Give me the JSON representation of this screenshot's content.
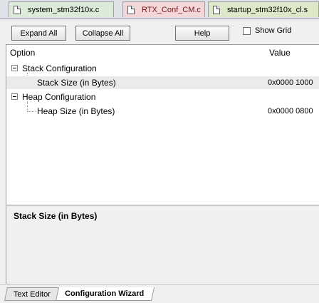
{
  "file_tabs": [
    {
      "label": "system_stm32f10x.c"
    },
    {
      "label": "RTX_Conf_CM.c"
    },
    {
      "label": "startup_stm32f10x_cl.s"
    }
  ],
  "toolbar": {
    "expand_all": "Expand All",
    "collapse_all": "Collapse All",
    "help": "Help",
    "show_grid": "Show Grid",
    "show_grid_checked": false
  },
  "grid": {
    "col_option": "Option",
    "col_value": "Value",
    "items": [
      {
        "label": "Stack Configuration",
        "type": "group",
        "expanded": true
      },
      {
        "label": "Stack Size (in Bytes)",
        "value": "0x0000 1000",
        "type": "option",
        "selected": true
      },
      {
        "label": "Heap Configuration",
        "type": "group",
        "expanded": true
      },
      {
        "label": "Heap Size (in Bytes)",
        "value": "0x0000 0800",
        "type": "option",
        "selected": false
      }
    ]
  },
  "description": {
    "title": "Stack Size (in Bytes)"
  },
  "bottom_tabs": [
    {
      "label": "Text Editor",
      "active": false
    },
    {
      "label": "Configuration Wizard",
      "active": true
    }
  ]
}
